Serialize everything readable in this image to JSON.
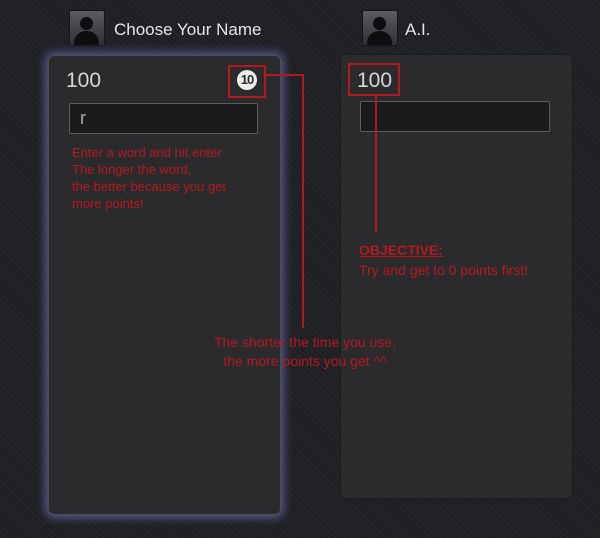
{
  "players": [
    {
      "name": "Choose Your Name",
      "score": "100",
      "input_value": "r",
      "active": true,
      "timer": "10"
    },
    {
      "name": "A.I.",
      "score": "100",
      "input_value": "",
      "active": false
    }
  ],
  "annotations": {
    "instructions": [
      "Enter a word and hit enter",
      "The longer the word,",
      "the better because you get",
      "more points!"
    ],
    "objective_title": "OBJECTIVE:",
    "objective_text": "Try and get to 0 points first!",
    "time_tip": [
      "The shorter the time you use,",
      "the more points you get ^^"
    ]
  },
  "colors": {
    "annotation_red": "#b3191f",
    "active_glow": "#8282e1",
    "panel_bg": "#2b2b2d"
  },
  "icons": {
    "avatar": "user-silhouette-icon",
    "timer": "countdown-timer-icon"
  }
}
